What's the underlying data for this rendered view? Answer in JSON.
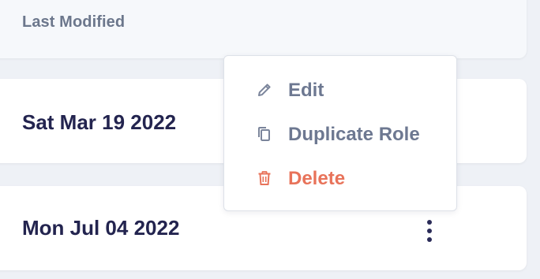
{
  "table": {
    "header": {
      "last_modified_label": "Last Modified"
    },
    "rows": [
      {
        "last_modified": "Sat Mar 19 2022"
      },
      {
        "last_modified": "Mon Jul 04 2022"
      }
    ]
  },
  "context_menu": {
    "items": [
      {
        "label": "Edit",
        "icon": "pencil-icon"
      },
      {
        "label": "Duplicate Role",
        "icon": "copy-icon"
      },
      {
        "label": "Delete",
        "icon": "trash-icon"
      }
    ]
  },
  "colors": {
    "text_primary": "#23244f",
    "text_muted": "#6c778c",
    "menu_text": "#6d7891",
    "danger": "#e8735a",
    "background": "#eef1f6"
  }
}
